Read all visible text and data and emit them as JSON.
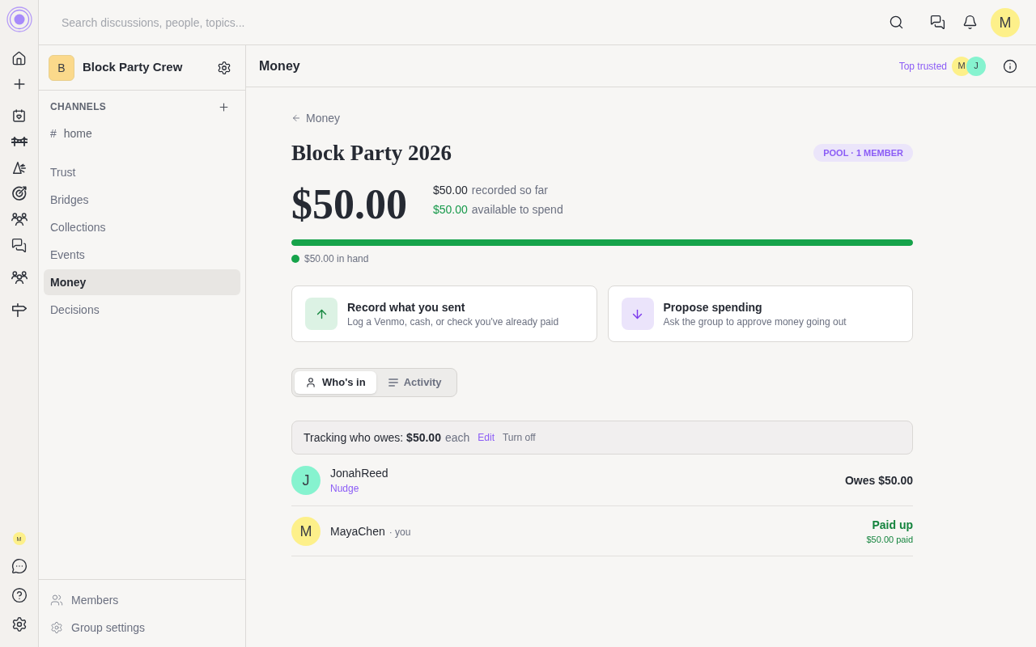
{
  "rail": {
    "avatar_initial": "M"
  },
  "topbar": {
    "search": {
      "placeholder": "Search discussions, people, topics..."
    },
    "avatar_initial": "M"
  },
  "sidebar": {
    "group": {
      "initial": "B",
      "name": "Block Party Crew"
    },
    "channels_heading": "CHANNELS",
    "channels": [
      {
        "prefix": "#",
        "name": "home"
      }
    ],
    "nav": [
      {
        "label": "Trust",
        "selected": false
      },
      {
        "label": "Bridges",
        "selected": false
      },
      {
        "label": "Collections",
        "selected": false
      },
      {
        "label": "Events",
        "selected": false
      },
      {
        "label": "Money",
        "selected": true
      },
      {
        "label": "Decisions",
        "selected": false
      }
    ],
    "footer": [
      {
        "kind": "members",
        "label": "Members"
      },
      {
        "kind": "settings",
        "label": "Group settings"
      }
    ]
  },
  "header": {
    "title": "Money",
    "top_trusted": {
      "label": "Top trusted",
      "avatars": [
        {
          "initial": "M",
          "color": "#fdf08a"
        },
        {
          "initial": "J",
          "color": "#86f3cf"
        }
      ]
    }
  },
  "pool": {
    "back": "Money",
    "title": "Block Party 2026",
    "badge": "POOL · 1 MEMBER",
    "total": "$50.00",
    "stats": [
      {
        "kind": "recorded",
        "amount": "$50.00",
        "label": "recorded so far"
      },
      {
        "kind": "available",
        "amount": "$50.00",
        "label": "available to spend"
      }
    ],
    "progress": {
      "level": 1,
      "color": "#16a34a",
      "legend": "$50.00 in hand"
    }
  },
  "actions": [
    {
      "kind": "record",
      "title": "Record what you sent",
      "subtitle": "Log a Venmo, cash, or check you've already paid"
    },
    {
      "kind": "propose",
      "title": "Propose spending",
      "subtitle": "Ask the group to approve money going out"
    }
  ],
  "tabs": [
    {
      "kind": "members",
      "label": "Who's in",
      "selected": true
    },
    {
      "kind": "activity",
      "label": "Activity",
      "selected": false
    }
  ],
  "tracking": {
    "text": "Tracking who owes: **$50.00**",
    "unit": "each",
    "edit": "Edit",
    "turn_off": "Turn off"
  },
  "members": [
    {
      "kind": "owes",
      "initial": "J",
      "color": "#86f3cf",
      "name": "JonahReed",
      "action": "Nudge",
      "status": "Owes $50.00"
    },
    {
      "kind": "paid",
      "initial": "M",
      "color": "#fdf08a",
      "name": "MayaChen",
      "note": "· you",
      "status": "Paid up",
      "detail": "$50.00 paid"
    }
  ]
}
